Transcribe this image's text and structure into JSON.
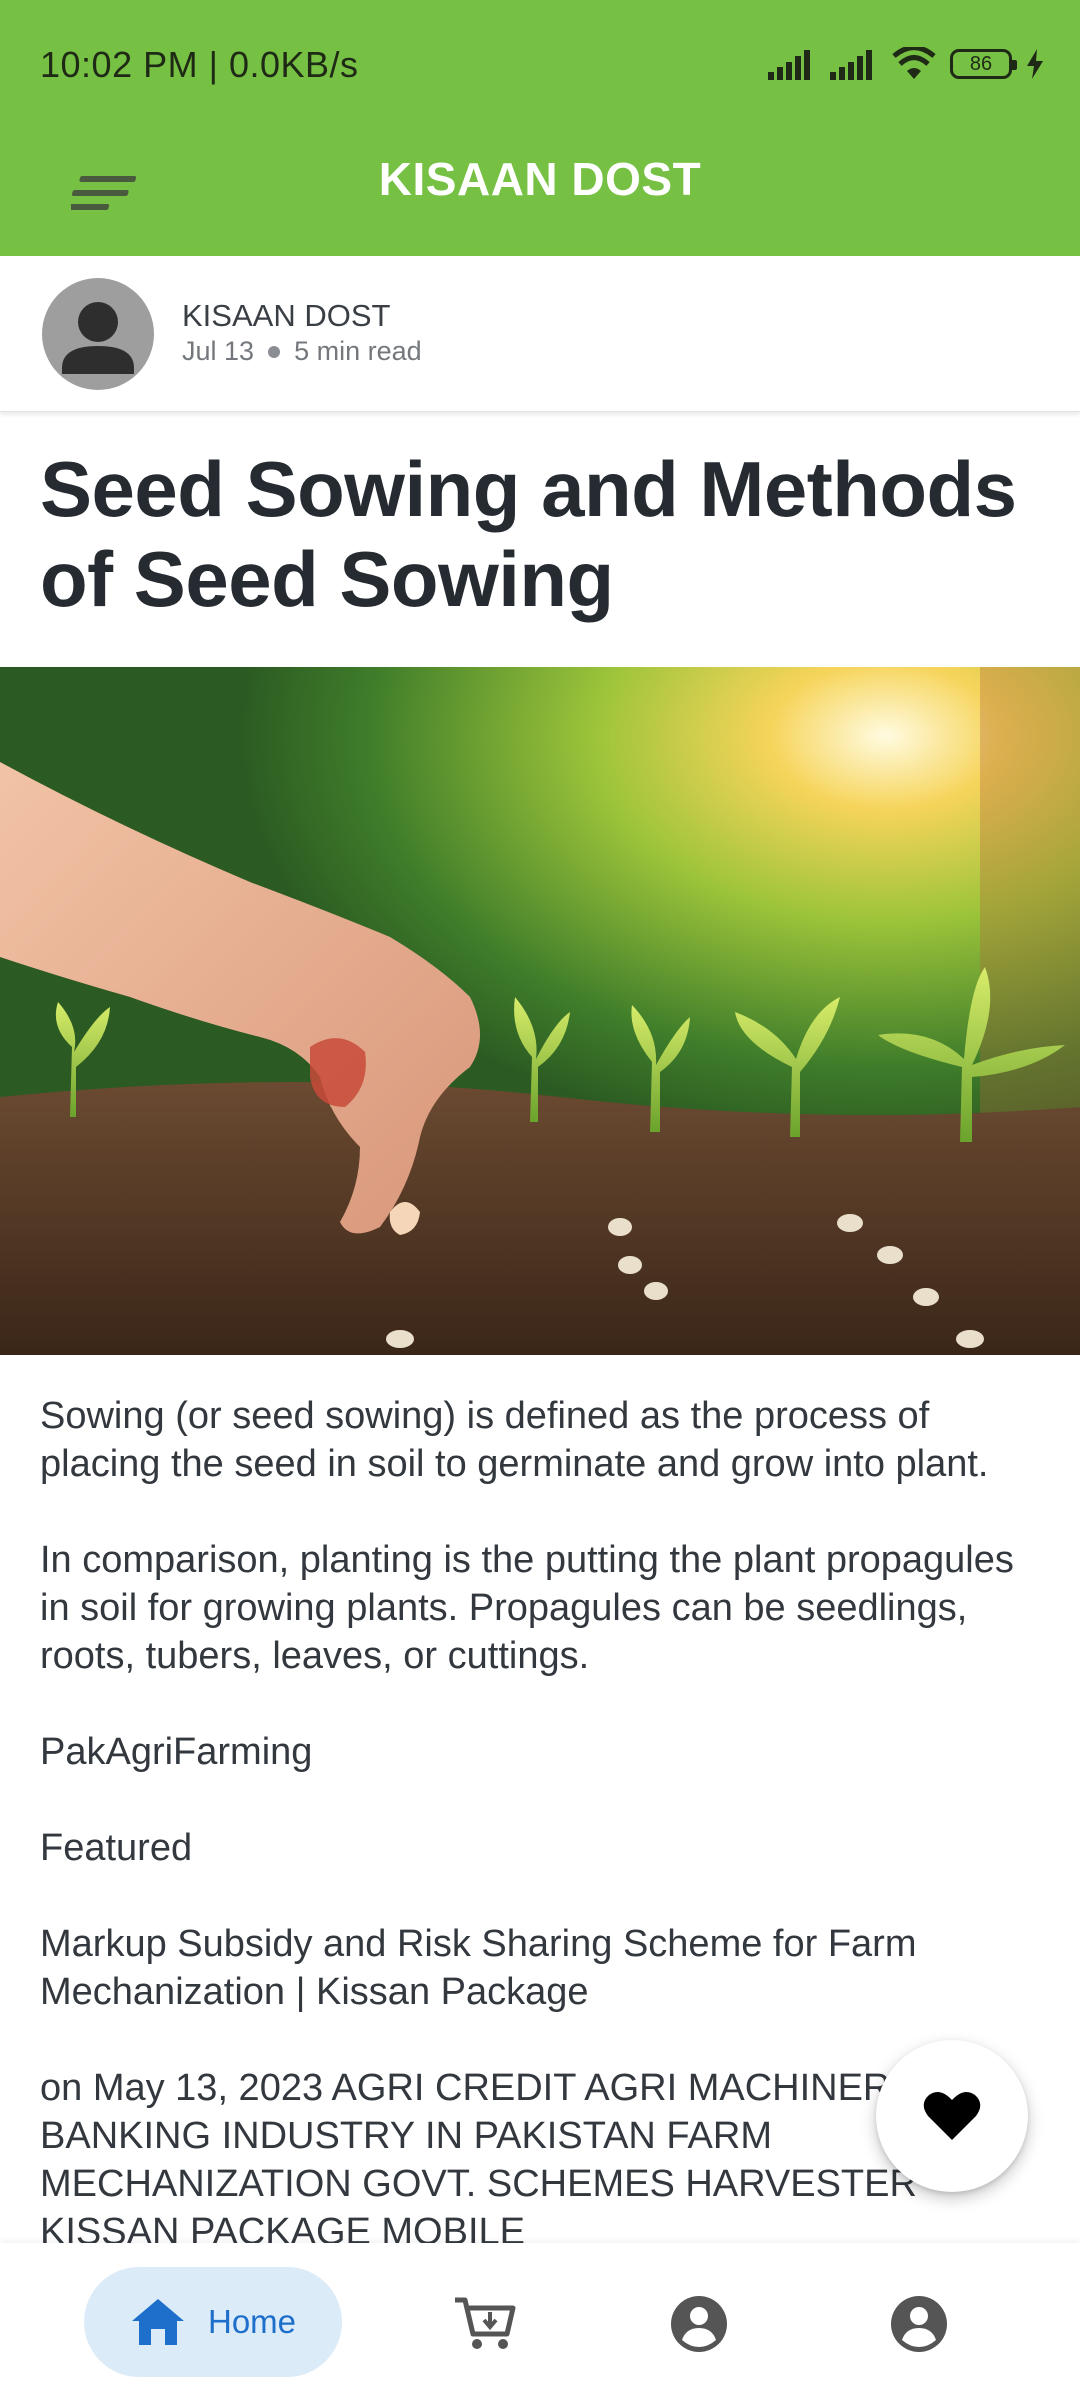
{
  "status_bar": {
    "time": "10:02 PM | 0.0KB/s",
    "battery": "86"
  },
  "app_bar": {
    "title": "KISAAN DOST",
    "menu_icon": "menu-icon"
  },
  "author": {
    "name": "KISAAN DOST",
    "date": "Jul 13",
    "read_time": "5 min read"
  },
  "article": {
    "title": "Seed Sowing and Methods of Seed Sowing",
    "paragraphs": [
      "Sowing (or seed sowing) is defined as the process of placing the seed in soil to germinate and grow into plant.",
      "In comparison, planting is the putting the plant propagules in soil for growing plants. Propagules can be seedlings, roots, tubers, leaves, or cuttings.",
      "PakAgriFarming",
      "Featured",
      "Markup Subsidy and Risk Sharing Scheme for Farm Mechanization | Kissan Package",
      "on May 13, 2023 AGRI CREDIT AGRI MACHINERY BANKING INDUSTRY IN PAKISTAN FARM MECHANIZATION GOVT. SCHEMES HARVESTER KISSAN PACKAGE MOBILE"
    ]
  },
  "fab": {
    "icon": "heart-icon"
  },
  "bottom_nav": {
    "home_label": "Home",
    "items": [
      "home-icon",
      "cart-icon",
      "account-icon",
      "profile-icon"
    ]
  },
  "colors": {
    "brand_green": "#76c043",
    "home_pill": "#dcebf8",
    "home_accent": "#1e6fcb"
  }
}
